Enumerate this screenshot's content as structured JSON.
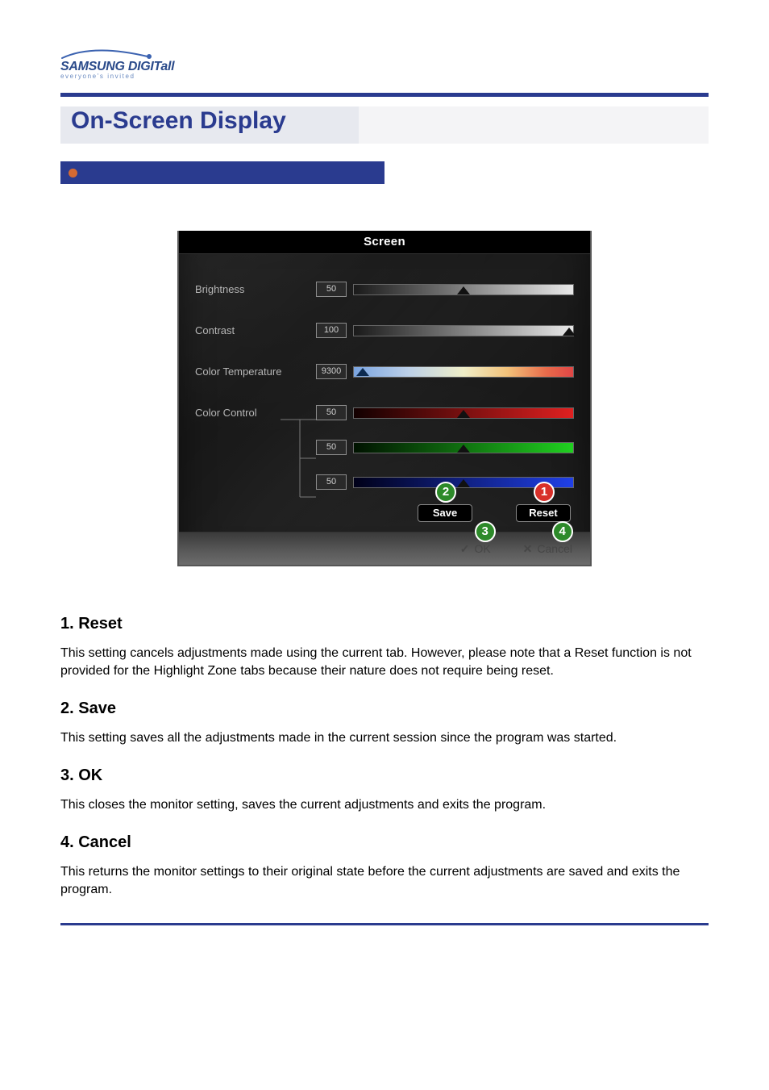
{
  "brand": {
    "name": "SAMSUNG DIGITall",
    "tagline": "everyone's invited"
  },
  "page_title": "On-Screen Display",
  "osd": {
    "title": "Screen",
    "rows": {
      "brightness": {
        "label": "Brightness",
        "value": "50",
        "handle_pct": 50
      },
      "contrast": {
        "label": "Contrast",
        "value": "100",
        "handle_pct": 98
      },
      "color_temperature": {
        "label": "Color Temperature",
        "value": "9300",
        "handle_pct": 4
      },
      "color_control": {
        "label": "Color Control",
        "r": {
          "value": "50",
          "handle_pct": 50
        },
        "g": {
          "value": "50",
          "handle_pct": 50
        },
        "b": {
          "value": "50",
          "handle_pct": 50
        }
      }
    },
    "buttons": {
      "save": "Save",
      "reset": "Reset",
      "ok": "OK",
      "cancel": "Cancel"
    },
    "callouts": {
      "reset": "1",
      "save": "2",
      "ok": "3",
      "cancel": "4"
    }
  },
  "sections": [
    {
      "heading": "1. Reset",
      "text": "This setting cancels adjustments made using the current tab. However, please note that a Reset function is not provided for the Highlight Zone tabs because their nature does not require being reset."
    },
    {
      "heading": "2. Save",
      "text": "This setting saves all the adjustments made in the current session since the program was started."
    },
    {
      "heading": "3. OK",
      "text": "This closes the monitor setting, saves the current adjustments and exits the program."
    },
    {
      "heading": "4. Cancel",
      "text": "This returns the monitor settings to their original state before the current adjustments are saved and exits the program."
    }
  ]
}
